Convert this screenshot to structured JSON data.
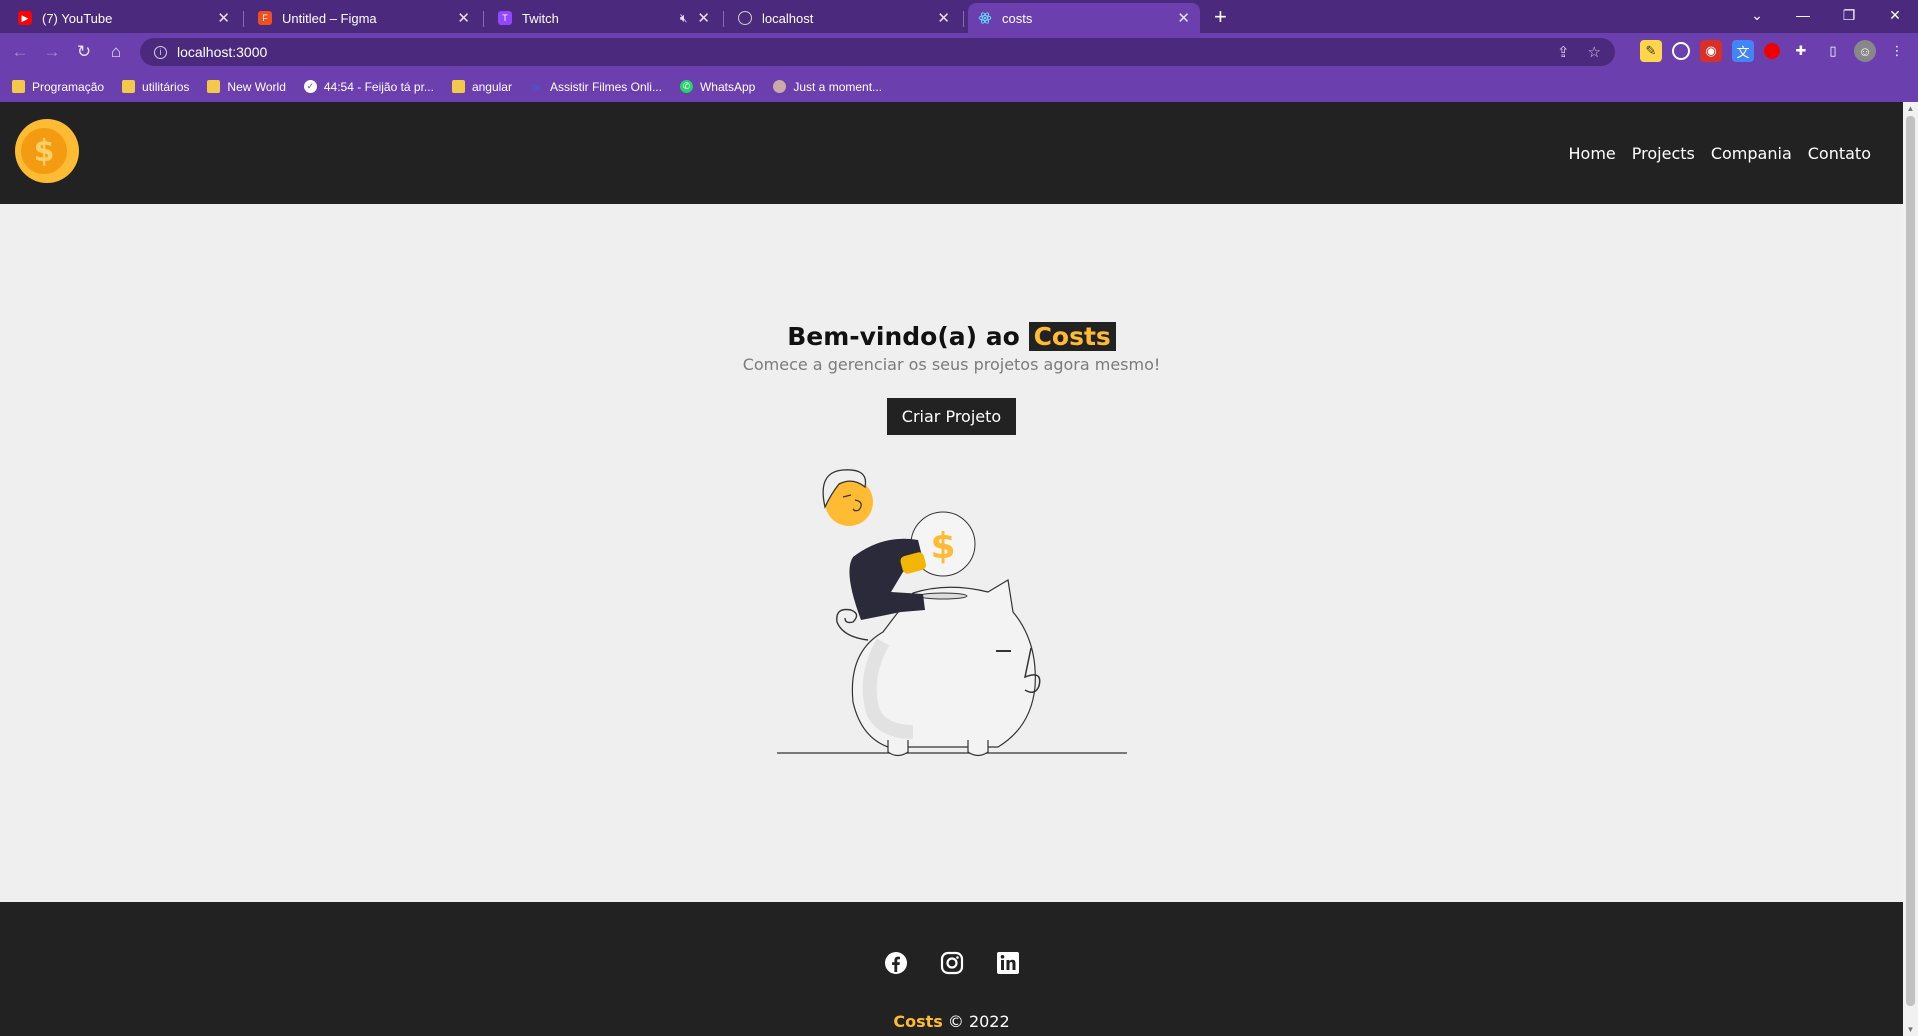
{
  "browser": {
    "tabs": [
      {
        "title": "(7) YouTube",
        "icon": "youtube-icon",
        "color": "#ff0000",
        "active": false
      },
      {
        "title": "Untitled – Figma",
        "icon": "figma-icon",
        "color": "#f24e1e",
        "active": false
      },
      {
        "title": "Twitch",
        "icon": "twitch-icon",
        "color": "#9146ff",
        "active": false,
        "muted": true
      },
      {
        "title": "localhost",
        "icon": "globe-icon",
        "color": "#cccccc",
        "active": false
      },
      {
        "title": "costs",
        "icon": "react-icon",
        "color": "#61dafb",
        "active": true
      }
    ],
    "url": "localhost:3000",
    "bookmarks": [
      {
        "label": "Programação",
        "icon": "folder-icon"
      },
      {
        "label": "utilitários",
        "icon": "folder-icon"
      },
      {
        "label": "New World",
        "icon": "folder-icon"
      },
      {
        "label": "44:54 - Feijão tá pr...",
        "icon": "check-circle-icon"
      },
      {
        "label": "angular",
        "icon": "folder-icon"
      },
      {
        "label": "Assistir Filmes Onli...",
        "icon": "film-icon"
      },
      {
        "label": "WhatsApp",
        "icon": "whatsapp-icon"
      },
      {
        "label": "Just a moment...",
        "icon": "avatar-icon"
      }
    ]
  },
  "site": {
    "nav": [
      "Home",
      "Projects",
      "Compania",
      "Contato"
    ],
    "hero": {
      "title_prefix": "Bem-vindo(a) ao",
      "brand": "Costs",
      "subtitle": "Comece a gerenciar os seus projetos agora mesmo!",
      "cta": "Criar Projeto"
    },
    "footer": {
      "social": [
        "facebook-icon",
        "instagram-icon",
        "linkedin-icon"
      ],
      "brand": "Costs",
      "copyright": "© 2022"
    },
    "colors": {
      "accent": "#ffbb33",
      "dark": "#222222",
      "background": "#efefef"
    }
  }
}
